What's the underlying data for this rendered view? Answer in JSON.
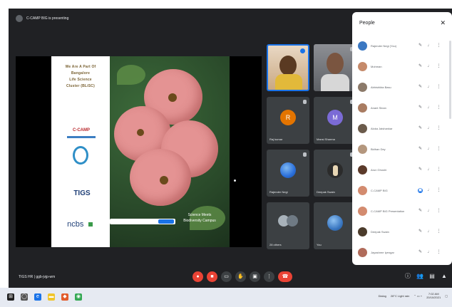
{
  "meeting": {
    "presenting_text": "C-CAMP BIG is presenting",
    "meeting_code": "TIGS HR",
    "meeting_time": "| ggb-jvjp-wm"
  },
  "slide": {
    "heading_lines": [
      "We Are A Part Of",
      "Bangalore",
      "Life Science",
      "Cluster (BLiSC)"
    ],
    "logos": [
      "C-CAMP",
      "TIGS",
      "ncbs"
    ],
    "caption": [
      "Science Meets",
      "Biodiversity Campus"
    ]
  },
  "video_tiles": [
    {
      "name": "",
      "kind": "video",
      "color": "#b58e63"
    },
    {
      "name": "",
      "kind": "video",
      "color": "#c9a074"
    },
    {
      "name": "Raj kumar",
      "kind": "initial",
      "initial": "R",
      "color": "#e37400"
    },
    {
      "name": "Mansi Sharma",
      "kind": "initial",
      "initial": "M",
      "color": "#7b6bd6"
    },
    {
      "name": "Rajender Negi",
      "kind": "photo",
      "color": "#2a6fdb"
    },
    {
      "name": "Deepak Swain",
      "kind": "photo",
      "color": "#444444"
    },
    {
      "name": "28 others",
      "kind": "group",
      "color": "#7a8187"
    },
    {
      "name": "You",
      "kind": "photo",
      "color": "#3b78c2"
    }
  ],
  "people_panel": {
    "title": "People",
    "participants": [
      {
        "name": "Rajender Negi (You)",
        "color": "#3b78c2"
      },
      {
        "name": "Mohman",
        "color": "#c58a6a"
      },
      {
        "name": "Abhishikta Basu",
        "color": "#8c7a6a"
      },
      {
        "name": "Anant Sinan",
        "color": "#a97c62"
      },
      {
        "name": "Aloka Jaishankar",
        "color": "#6b5b4b"
      },
      {
        "name": "Bidhan Dey",
        "color": "#b4977e"
      },
      {
        "name": "Arun Ghoshi",
        "color": "#5b3a2a"
      },
      {
        "name": "C-CAMP BIG",
        "color": "#d38b6f",
        "presenting": true
      },
      {
        "name": "C-CAMP BIG Presentation",
        "color": "#d38b6f"
      },
      {
        "name": "Deepak Swain",
        "color": "#4b3b2b"
      },
      {
        "name": "Jayashree Iyengar",
        "color": "#b06b5a"
      }
    ]
  },
  "controls": [
    "mic",
    "camera",
    "captions",
    "raise-hand",
    "present",
    "more",
    "end-call"
  ],
  "taskbar": {
    "search_text": "Dialog",
    "weather": "28°C Light rain",
    "time": "7:02 AM",
    "date": "20/10/2021"
  }
}
